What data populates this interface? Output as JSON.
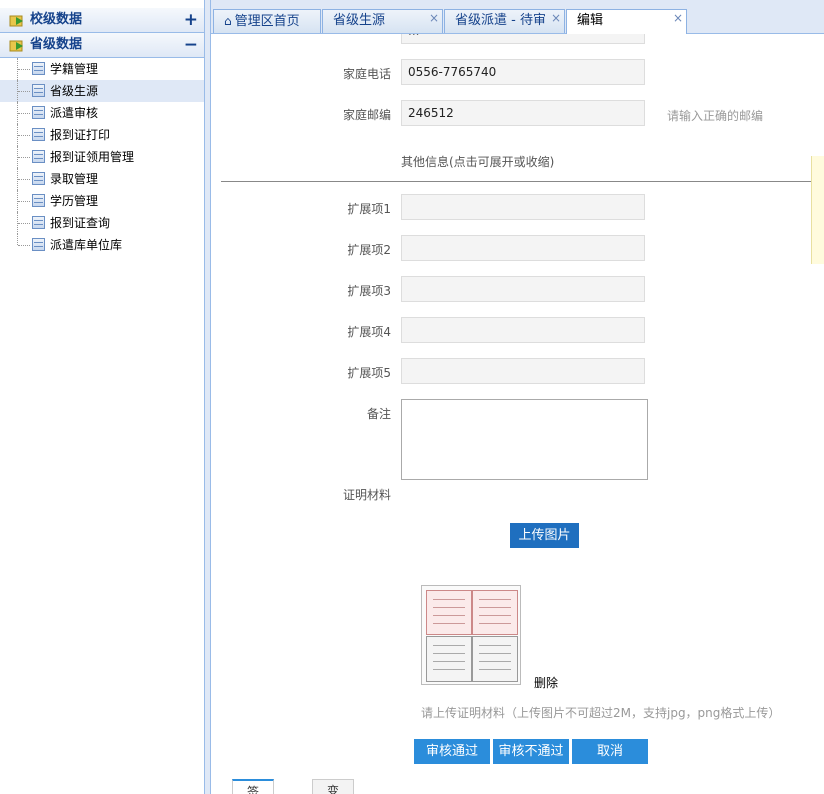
{
  "sidebar": {
    "sections": [
      {
        "title": "校级数据",
        "toggle": "+"
      },
      {
        "title": "省级数据",
        "toggle": "−"
      }
    ],
    "items": [
      {
        "label": "学籍管理"
      },
      {
        "label": "省级生源"
      },
      {
        "label": "派遣审核"
      },
      {
        "label": "报到证打印"
      },
      {
        "label": "报到证领用管理"
      },
      {
        "label": "录取管理"
      },
      {
        "label": "学历管理"
      },
      {
        "label": "报到证查询"
      },
      {
        "label": "派遣库单位库"
      }
    ]
  },
  "tabs": [
    {
      "label": "管理区首页",
      "icon": "home-icon"
    },
    {
      "label": "省级生源",
      "close": "×"
    },
    {
      "label": "省级派遣 - 待审",
      "close": "×"
    },
    {
      "label": "编辑",
      "close": "×"
    }
  ],
  "form": {
    "partial_top_value": "...",
    "home_phone_label": "家庭电话",
    "home_phone_value": "0556-7765740",
    "postcode_label": "家庭邮编",
    "postcode_value": "246512",
    "postcode_hint": "请输入正确的邮编",
    "other_info": "其他信息(点击可展开或收缩)",
    "ext_labels": [
      "扩展项1",
      "扩展项2",
      "扩展项3",
      "扩展项4",
      "扩展项5"
    ],
    "remark_label": "备注",
    "proof_label": "证明材料",
    "upload_button": "上传图片",
    "delete_link": "删除",
    "upload_hint": "请上传证明材料（上传图片不可超过2M，支持jpg，png格式上传）",
    "approve_button": "审核通过",
    "reject_button": "审核不通过",
    "cancel_button": "取消"
  },
  "bottom_tabs": [
    "签核记录",
    "变更明细"
  ],
  "colors": {
    "accent": "#2b8ddb",
    "header_text": "#15428b",
    "border": "#99bbe8"
  }
}
